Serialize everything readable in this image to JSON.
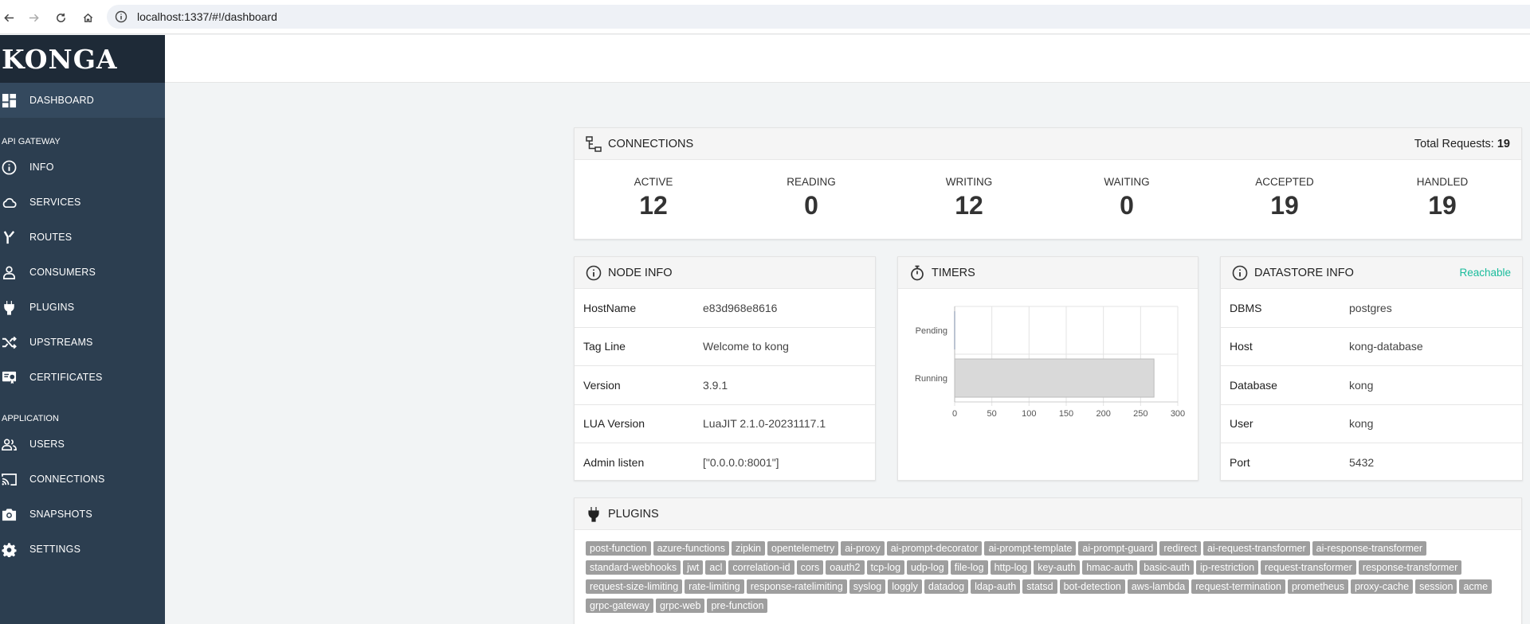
{
  "browser": {
    "url": "localhost:1337/#!/dashboard"
  },
  "sidebar": {
    "logo": "KONGA",
    "dashboard": "DASHBOARD",
    "section_gateway": "API GATEWAY",
    "gateway_items": [
      {
        "label": "INFO",
        "icon": "info-icon"
      },
      {
        "label": "SERVICES",
        "icon": "cloud-icon"
      },
      {
        "label": "ROUTES",
        "icon": "fork-icon"
      },
      {
        "label": "CONSUMERS",
        "icon": "user-icon"
      },
      {
        "label": "PLUGINS",
        "icon": "plug-icon"
      },
      {
        "label": "UPSTREAMS",
        "icon": "shuffle-icon"
      },
      {
        "label": "CERTIFICATES",
        "icon": "certificate-icon"
      }
    ],
    "section_application": "APPLICATION",
    "app_items": [
      {
        "label": "USERS",
        "icon": "users-icon"
      },
      {
        "label": "CONNECTIONS",
        "icon": "cast-icon"
      },
      {
        "label": "SNAPSHOTS",
        "icon": "camera-icon"
      },
      {
        "label": "SETTINGS",
        "icon": "gear-icon"
      }
    ]
  },
  "connections": {
    "title": "CONNECTIONS",
    "total_label": "Total Requests:",
    "total_value": "19",
    "stats": [
      {
        "label": "ACTIVE",
        "value": "12"
      },
      {
        "label": "READING",
        "value": "0"
      },
      {
        "label": "WRITING",
        "value": "12"
      },
      {
        "label": "WAITING",
        "value": "0"
      },
      {
        "label": "ACCEPTED",
        "value": "19"
      },
      {
        "label": "HANDLED",
        "value": "19"
      }
    ]
  },
  "node_info": {
    "title": "NODE INFO",
    "rows": [
      {
        "key": "HostName",
        "value": "e83d968e8616"
      },
      {
        "key": "Tag Line",
        "value": "Welcome to kong"
      },
      {
        "key": "Version",
        "value": "3.9.1"
      },
      {
        "key": "LUA Version",
        "value": "LuaJIT 2.1.0-20231117.1"
      },
      {
        "key": "Admin listen",
        "value": "[\"0.0.0.0:8001\"]"
      }
    ]
  },
  "timers": {
    "title": "TIMERS",
    "chart_data": {
      "type": "bar",
      "orientation": "horizontal",
      "categories": [
        "Pending",
        "Running"
      ],
      "values": [
        0,
        268
      ],
      "xlim": [
        0,
        300
      ],
      "xticks": [
        0,
        50,
        100,
        150,
        200,
        250,
        300
      ],
      "grid": true,
      "bar_color": "#d9d9d9"
    }
  },
  "datastore": {
    "title": "DATASTORE INFO",
    "status": "Reachable",
    "rows": [
      {
        "key": "DBMS",
        "value": "postgres"
      },
      {
        "key": "Host",
        "value": "kong-database"
      },
      {
        "key": "Database",
        "value": "kong"
      },
      {
        "key": "User",
        "value": "kong"
      },
      {
        "key": "Port",
        "value": "5432"
      }
    ]
  },
  "plugins": {
    "title": "PLUGINS",
    "tags": [
      "post-function",
      "azure-functions",
      "zipkin",
      "opentelemetry",
      "ai-proxy",
      "ai-prompt-decorator",
      "ai-prompt-template",
      "ai-prompt-guard",
      "redirect",
      "ai-request-transformer",
      "ai-response-transformer",
      "standard-webhooks",
      "jwt",
      "acl",
      "correlation-id",
      "cors",
      "oauth2",
      "tcp-log",
      "udp-log",
      "file-log",
      "http-log",
      "key-auth",
      "hmac-auth",
      "basic-auth",
      "ip-restriction",
      "request-transformer",
      "response-transformer",
      "request-size-limiting",
      "rate-limiting",
      "response-ratelimiting",
      "syslog",
      "loggly",
      "datadog",
      "ldap-auth",
      "statsd",
      "bot-detection",
      "aws-lambda",
      "request-termination",
      "prometheus",
      "proxy-cache",
      "session",
      "acme",
      "grpc-gateway",
      "grpc-web",
      "pre-function"
    ]
  }
}
